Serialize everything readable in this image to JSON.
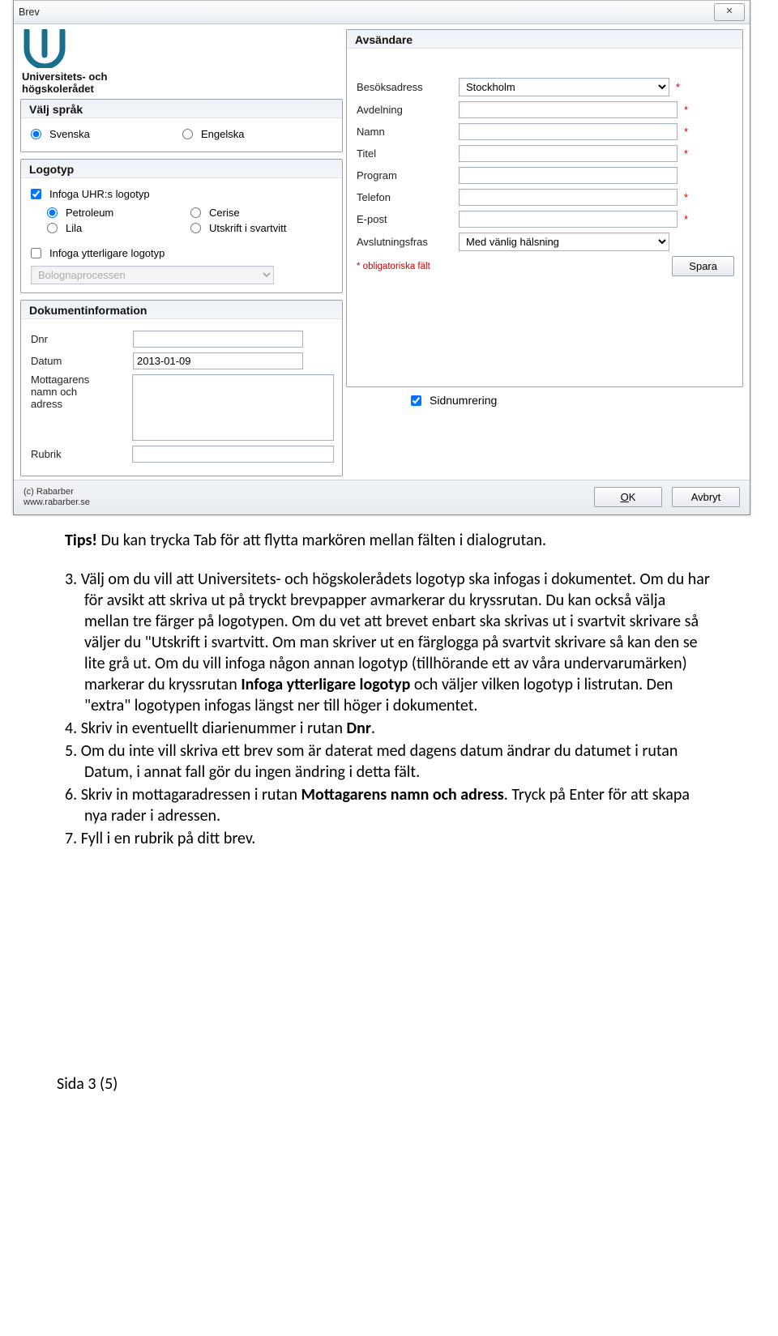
{
  "dialog": {
    "title": "Brev",
    "close": "✕",
    "logo_name_line1": "Universitets- och",
    "logo_name_line2": "högskolerådet",
    "lang": {
      "title": "Välj språk",
      "sv": "Svenska",
      "en": "Engelska"
    },
    "logotyp": {
      "title": "Logotyp",
      "insert_uhr": "Infoga UHR:s logotyp",
      "petroleum": "Petroleum",
      "cerise": "Cerise",
      "lila": "Lila",
      "bw": "Utskrift i svartvitt",
      "insert_extra": "Infoga ytterligare logotyp",
      "extra_value": "Bolognaprocessen"
    },
    "docinfo": {
      "title": "Dokumentinformation",
      "dnr_label": "Dnr",
      "dnr_value": "",
      "date_label": "Datum",
      "date_value": "2013-01-09",
      "recipient_label_l1": "Mottagarens",
      "recipient_label_l2": "namn och",
      "recipient_label_l3": "adress",
      "recipient_value": "",
      "subject_label": "Rubrik",
      "subject_value": ""
    },
    "sender": {
      "title": "Avsändare",
      "visit_label": "Besöksadress",
      "visit_value": "Stockholm",
      "dept_label": "Avdelning",
      "dept_value": "",
      "name_label": "Namn",
      "name_value": "",
      "title_label": "Titel",
      "title_value": "",
      "program_label": "Program",
      "program_value": "",
      "phone_label": "Telefon",
      "phone_value": "",
      "email_label": "E-post",
      "email_value": "",
      "closing_label": "Avslutningsfras",
      "closing_value": "Med vänlig hälsning",
      "mandatory_note": "* obligatoriska fält",
      "save": "Spara",
      "pagination": "Sidnumrering"
    },
    "footer": {
      "credit_l1": "(c) Rabarber",
      "credit_l2": "www.rabarber.se",
      "ok": "OK",
      "cancel": "Avbryt"
    }
  },
  "body": {
    "tips_lead": "Tips!",
    "tips_rest": " Du kan trycka Tab för att flytta markören mellan fälten i dialogrutan.",
    "i3_full": "3. Välj om du vill att Universitets- och högskolerådets logotyp ska infogas i dokumentet. Om du har för avsikt att skriva ut på tryckt brevpapper avmarkerar du kryssrutan. Du kan också välja mellan tre färger på logotypen. Om du vet att brevet enbart ska skrivas ut i svartvit skrivare så väljer du \"Utskrift i svartvitt. Om man skriver ut en färglogga på svartvit skrivare så kan den se lite grå ut. Om du vill infoga någon annan logotyp (tillhörande ett av våra undervarumärken) markerar du kryssrutan ",
    "i3_bold": "Infoga ytterligare logotyp",
    "i3_tail": " och väljer vilken logotyp i listrutan. Den \"extra\" logotypen infogas längst ner till höger i dokumentet.",
    "i4_a": "4. Skriv in eventuellt diarienummer i rutan ",
    "i4_b": "Dnr",
    "i4_c": ".",
    "i5": "5. Om du inte vill skriva ett brev som är daterat med dagens datum ändrar du datumet i rutan Datum, i annat fall gör du ingen ändring i detta fält.",
    "i6_a": "6. Skriv in mottagaradressen i rutan ",
    "i6_b": "Mottagarens namn och adress",
    "i6_c": ". Tryck på Enter för att skapa nya rader i adressen.",
    "i7": "7. Fyll i en rubrik på ditt brev.",
    "page_num": "Sida 3 (5)"
  }
}
